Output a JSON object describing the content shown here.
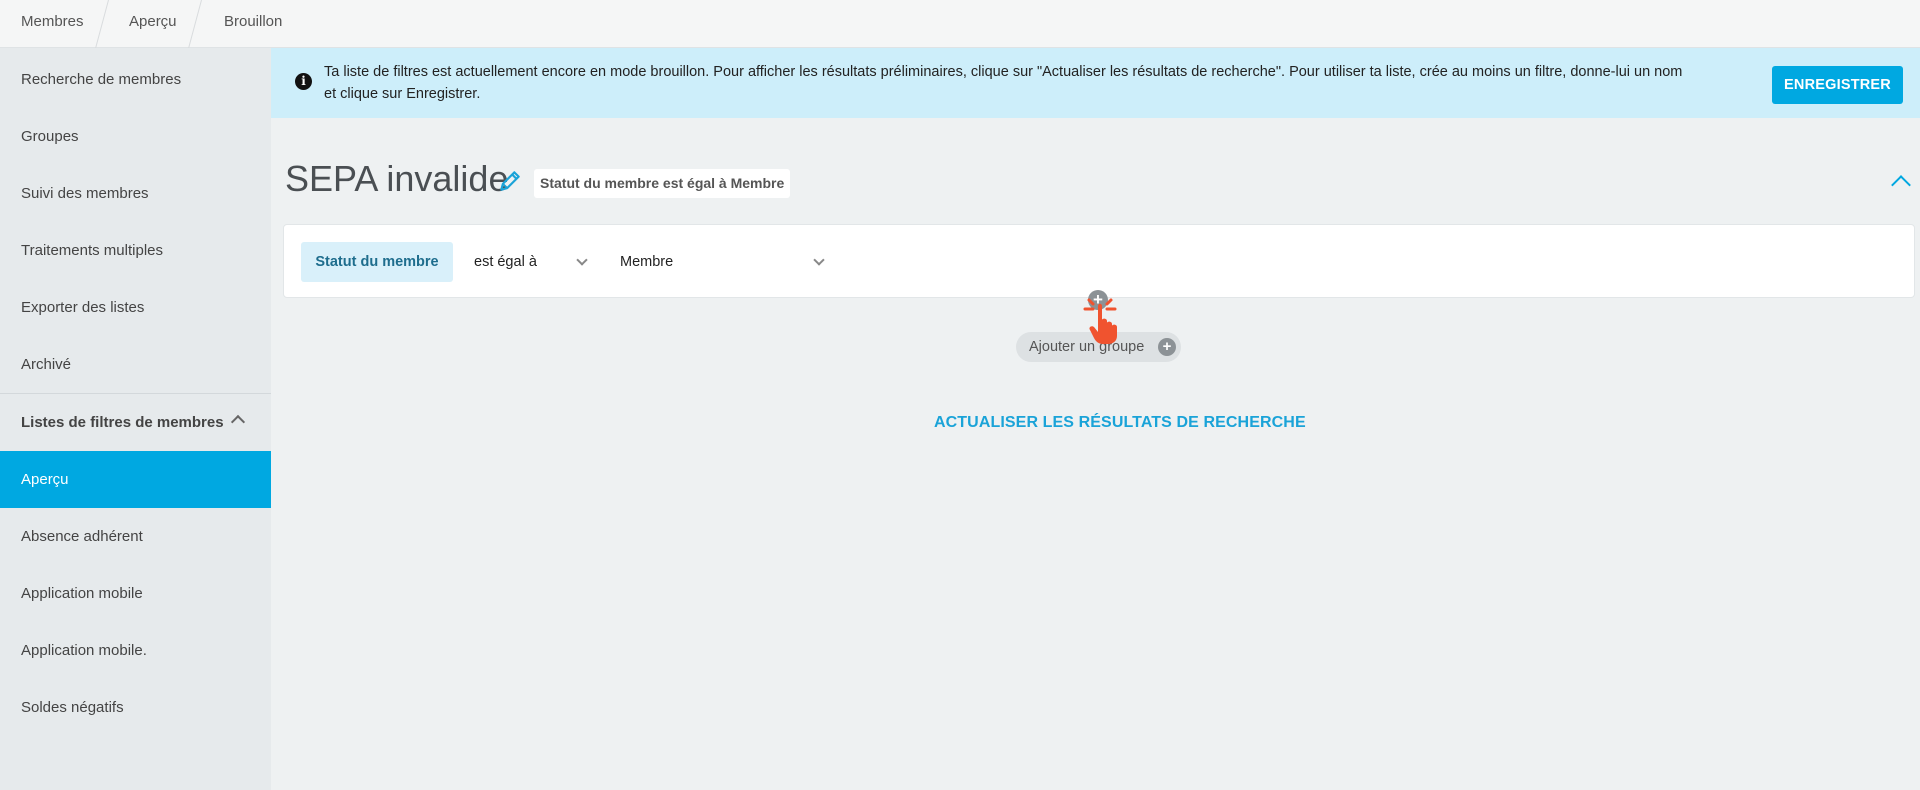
{
  "breadcrumb": {
    "items": [
      "Membres",
      "Aperçu",
      "Brouillon"
    ]
  },
  "sidebar": {
    "items": [
      {
        "label": "Recherche de membres"
      },
      {
        "label": "Groupes"
      },
      {
        "label": "Suivi des membres"
      },
      {
        "label": "Traitements multiples"
      },
      {
        "label": "Exporter des listes"
      },
      {
        "label": "Archivé"
      }
    ],
    "section": {
      "label": "Listes de filtres de membres",
      "expanded": true,
      "items": [
        {
          "label": "Aperçu",
          "active": true
        },
        {
          "label": "Absence adhérent"
        },
        {
          "label": "Application mobile"
        },
        {
          "label": "Application mobile."
        },
        {
          "label": "Soldes négatifs"
        }
      ]
    }
  },
  "banner": {
    "icon": "info-icon",
    "text": "Ta liste de filtres est actuellement encore en mode brouillon. Pour afficher les résultats préliminaires, clique sur \"Actualiser les résultats de recherche\". Pour utiliser ta liste, crée au moins un filtre, donne-lui un nom et clique sur Enregistrer.",
    "save_label": "ENREGISTRER"
  },
  "filter_list": {
    "title": "SEPA invalide",
    "summary": "Statut du membre est égal à Membre"
  },
  "condition": {
    "field": "Statut du membre",
    "operator": "est égal à",
    "value": "Membre"
  },
  "actions": {
    "add_group_label": "Ajouter un groupe",
    "refresh_label": "ACTUALISER LES RÉSULTATS DE RECHERCHE"
  },
  "colors": {
    "accent": "#00a8e1",
    "banner_bg": "#cdeefa",
    "sidebar_bg": "#e6eaec",
    "cursor": "#f0532f"
  }
}
